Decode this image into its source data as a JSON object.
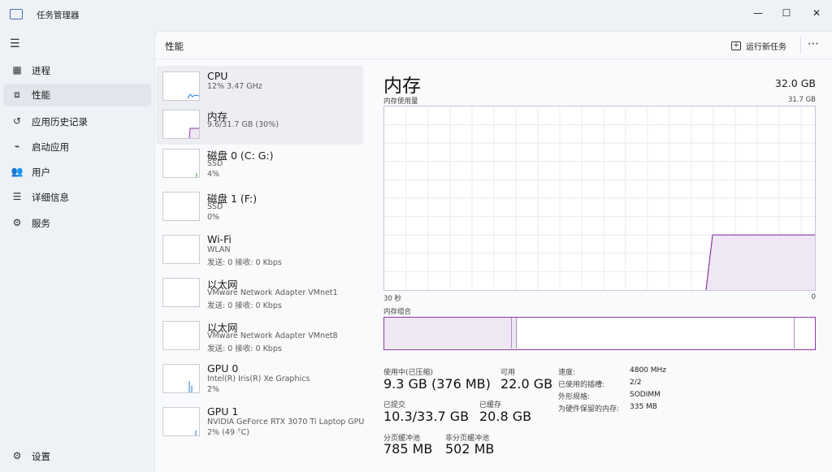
{
  "window": {
    "title": "任务管理器"
  },
  "nav": {
    "items": [
      {
        "label": "进程",
        "icon": "processes-icon"
      },
      {
        "label": "性能",
        "icon": "performance-icon"
      },
      {
        "label": "应用历史记录",
        "icon": "app-history-icon"
      },
      {
        "label": "启动应用",
        "icon": "startup-apps-icon"
      },
      {
        "label": "用户",
        "icon": "users-icon"
      },
      {
        "label": "详细信息",
        "icon": "details-icon"
      },
      {
        "label": "服务",
        "icon": "services-icon"
      }
    ],
    "settings": "设置"
  },
  "header": {
    "title": "性能",
    "run_task": "运行新任务"
  },
  "devices": [
    {
      "name": "CPU",
      "line2": "12%  3.47 GHz",
      "line3": ""
    },
    {
      "name": "内存",
      "line2": "9.6/31.7 GB (30%)",
      "line3": ""
    },
    {
      "name": "磁盘 0 (C: G:)",
      "line2": "SSD",
      "line3": "4%"
    },
    {
      "name": "磁盘 1 (F:)",
      "line2": "SSD",
      "line3": "0%"
    },
    {
      "name": "Wi-Fi",
      "line2": "WLAN",
      "line3": "发送: 0 接收: 0 Kbps"
    },
    {
      "name": "以太网",
      "line2": "VMware Network Adapter VMnet1",
      "line3": "发送: 0 接收: 0 Kbps"
    },
    {
      "name": "以太网",
      "line2": "VMware Network Adapter VMnet8",
      "line3": "发送: 0 接收: 0 Kbps"
    },
    {
      "name": "GPU 0",
      "line2": "Intel(R) Iris(R) Xe Graphics",
      "line3": "2%"
    },
    {
      "name": "GPU 1",
      "line2": "NVIDIA GeForce RTX 3070 Ti Laptop GPU",
      "line3": "2% (49 °C)"
    }
  ],
  "detail": {
    "title": "内存",
    "capacity": "32.0 GB",
    "graph_label": "内存使用量",
    "graph_max": "31.7 GB",
    "axis_left": "30 秒",
    "axis_right": "0",
    "composition_label": "内存组合",
    "stats": {
      "in_use_label": "使用中(已压缩)",
      "in_use_value": "9.3 GB (376 MB)",
      "available_label": "可用",
      "available_value": "22.0 GB",
      "committed_label": "已提交",
      "committed_value": "10.3/33.7 GB",
      "cached_label": "已缓存",
      "cached_value": "20.8 GB",
      "paged_label": "分页缓冲池",
      "paged_value": "785 MB",
      "nonpaged_label": "非分页缓冲池",
      "nonpaged_value": "502 MB"
    },
    "info": [
      {
        "k": "速度:",
        "v": "4800 MHz"
      },
      {
        "k": "已使用的插槽:",
        "v": "2/2"
      },
      {
        "k": "外形规格:",
        "v": "SODIMM"
      },
      {
        "k": "为硬件保留的内存:",
        "v": "335 MB"
      }
    ]
  },
  "usage_fraction": 0.3,
  "colors": {
    "memory": "#8a39a8",
    "memory_fill": "#efe7f3",
    "cpu": "#1f7ae0",
    "accent": "#5b52c7"
  }
}
